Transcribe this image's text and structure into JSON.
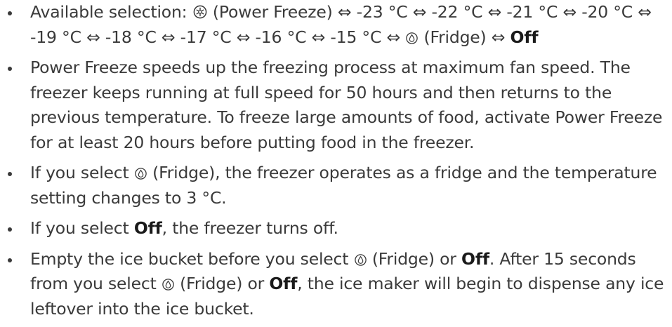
{
  "bullets": [
    {
      "segments": [
        "Available selection: ",
        " (Power Freeze) ⇔ -23 °C ⇔ -22 °C ⇔ -21 °C ⇔ -20 °C ⇔ -19 °C ⇔ -18 °C ⇔ -17 °C ⇔ -16 °C ⇔ -15 °C ⇔ ",
        " (Fridge) ⇔ ",
        "Off"
      ]
    },
    {
      "text": "Power Freeze speeds up the freezing process at maximum fan speed. The freezer keeps running at full speed for 50 hours and then returns to the previous temperature. To freeze large amounts of food, activate Power Freeze for at least 20 hours before putting food in the freezer."
    },
    {
      "segments": [
        "If you select ",
        " (Fridge), the freezer operates as a fridge and the temperature setting changes to 3 °C."
      ]
    },
    {
      "segments": [
        "If you select ",
        "Off",
        ", the freezer turns off."
      ]
    },
    {
      "segments": [
        "Empty the ice bucket before you select ",
        " (Fridge) or ",
        "Off",
        ". After 15 seconds from you select ",
        " (Fridge) or ",
        "Off",
        ", the ice maker will begin to dispense any ice leftover into the ice bucket."
      ]
    }
  ],
  "icons": {
    "power_freeze": "power-freeze-icon",
    "fridge": "fridge-drop-icon"
  }
}
